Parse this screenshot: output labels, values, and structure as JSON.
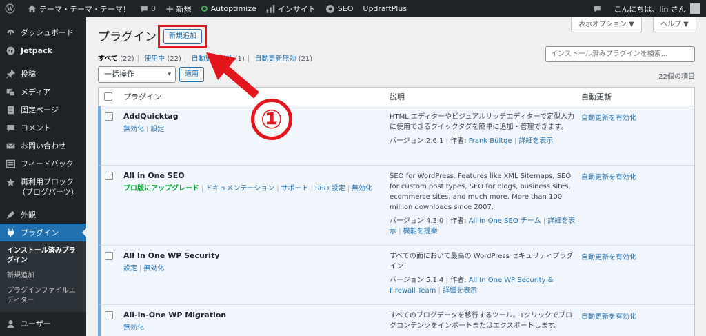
{
  "adminbar": {
    "site_name": "テーマ・テーマ・テーマ！",
    "comments": "0",
    "new_label": "新規",
    "autoptimize": "Autoptimize",
    "insight": "インサイト",
    "seo": "SEO",
    "updraft": "UpdraftPlus",
    "greeting": "こんにちは、lin さん"
  },
  "sidebar": {
    "items": [
      {
        "label": "ダッシュボード",
        "icon": "dashboard-icon"
      },
      {
        "label": "Jetpack",
        "icon": "jetpack-icon"
      },
      {
        "label": "投稿",
        "icon": "pin-icon"
      },
      {
        "label": "メディア",
        "icon": "media-icon"
      },
      {
        "label": "固定ページ",
        "icon": "page-icon"
      },
      {
        "label": "コメント",
        "icon": "comment-icon"
      },
      {
        "label": "お問い合わせ",
        "icon": "mail-icon"
      },
      {
        "label": "フィードバック",
        "icon": "feedback-icon"
      },
      {
        "label": "再利用ブロック（ブログパーツ）",
        "line1": "再利用ブロック",
        "line2": "（ブログパーツ）",
        "icon": "star-icon"
      },
      {
        "label": "外観",
        "icon": "appearance-icon"
      },
      {
        "label": "プラグイン",
        "icon": "plugin-icon"
      },
      {
        "label": "ユーザー",
        "icon": "user-icon"
      }
    ],
    "submenu": {
      "installed": "インストール済みプラグイン",
      "add_new": "新規追加",
      "editor": "プラグインファイルエディター"
    }
  },
  "header": {
    "title": "プラグイン",
    "add_new": "新規追加",
    "screen_options": "表示オプション ▼",
    "help": "ヘルプ ▼"
  },
  "views": {
    "all": "すべて",
    "all_count": "(22)",
    "active": "使用中",
    "active_count": "(22)",
    "auto_on": "自動更新有効",
    "auto_on_count": "(1)",
    "auto_off": "自動更新無効",
    "auto_off_count": "(21)"
  },
  "search": {
    "placeholder": "インストール済みプラグインを検索..."
  },
  "bulk": {
    "label": "一括操作",
    "apply": "適用",
    "count": "22個の項目"
  },
  "table": {
    "col_plugin": "プラグイン",
    "col_desc": "説明",
    "col_auto": "自動更新",
    "rows": [
      {
        "name": "AddQuicktag",
        "actions": [
          "無効化",
          "設定"
        ],
        "desc": "HTML エディターやビジュアルリッチエディターで定型入力に使用できるクイックタグを簡単に追加・管理できます。",
        "version": "バージョン 2.6.1 | 作者: ",
        "author": "Frank Bültge",
        "extra": "詳細を表示",
        "auto": "自動更新を有効化"
      },
      {
        "name": "All in One SEO",
        "upgrade": "プロ版にアップグレード",
        "actions": [
          "ドキュメンテーション",
          "サポート",
          "SEO 設定",
          "無効化"
        ],
        "desc": "SEO for WordPress. Features like XML Sitemaps, SEO for custom post types, SEO for blogs, business sites, ecommerce sites, and much more. More than 100 million downloads since 2007.",
        "version": "バージョン 4.3.0 | 作者: ",
        "author": "All in One SEO チーム",
        "extra": "詳細を表示",
        "extra2": "機能を提案",
        "auto": "自動更新を有効化"
      },
      {
        "name": "All In One WP Security",
        "actions": [
          "設定",
          "無効化"
        ],
        "desc": "すべての面において最高の WordPress セキュリティプラグイン！",
        "version": "バージョン 5.1.4 | 作者: ",
        "author": "All In One WP Security & Firewall Team",
        "extra": "詳細を表示",
        "auto": "自動更新を有効化"
      },
      {
        "name": "All-in-One WP Migration",
        "actions": [
          "無効化"
        ],
        "desc": "すべてのブログデータを移行するツール。1クリックでブログコンテンツをインポートまたはエクスポートします。",
        "auto": "自動更新を有効化"
      }
    ]
  },
  "annotation": {
    "marker": "①",
    "accent": "#e2161c"
  }
}
